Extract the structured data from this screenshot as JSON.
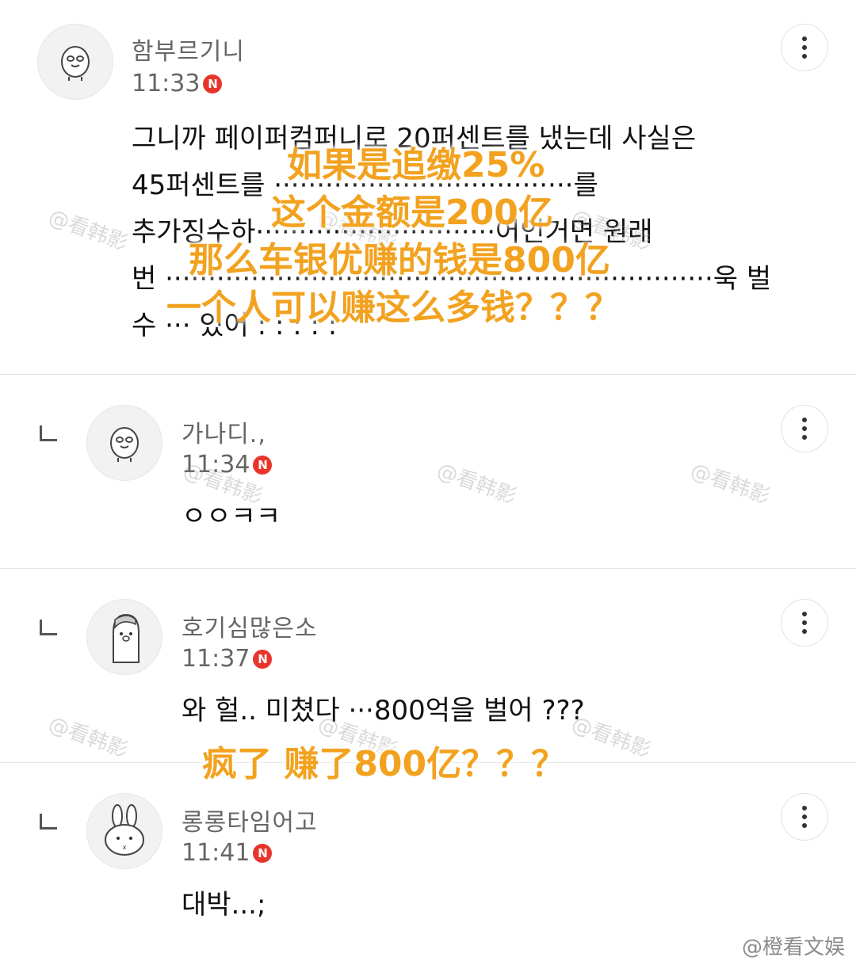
{
  "comments": [
    {
      "username": "함부르기니",
      "time": "11:33",
      "badge": "N",
      "text": "그니까 페이퍼컴퍼니로 20퍼센트를 냈는데 사실은\n45퍼센트를 ···································를\n추가징수하····························어인거면 원래\n번 ································································욱 벌\n수 ··· 있어 : : : : :"
    },
    {
      "username": "가나디.,",
      "time": "11:34",
      "badge": "N",
      "text": "ㅇㅇㅋㅋ"
    },
    {
      "username": "호기심많은소",
      "time": "11:37",
      "badge": "N",
      "text": "와 헐.. 미쳤다 ···800억을 벌어 ???"
    },
    {
      "username": "롱롱타임어고",
      "time": "11:41",
      "badge": "N",
      "text": "대박...;"
    }
  ],
  "overlay_caption_1": [
    "如果是追缴25%",
    "这个金额是200亿",
    "那么车银优赚的钱是800亿",
    "一个人可以赚这么多钱？？？"
  ],
  "overlay_caption_2": "疯了 赚了800亿？？？",
  "watermark": "@看韩影",
  "footer_watermark": "@橙看文娱",
  "colors": {
    "overlay": "#f2a21f",
    "badge": "#e8352b",
    "divider": "#e4e4e4"
  },
  "icons": {
    "more": "more-vertical-icon",
    "reply": "reply-arrow-icon",
    "badge": "new-badge-icon"
  }
}
